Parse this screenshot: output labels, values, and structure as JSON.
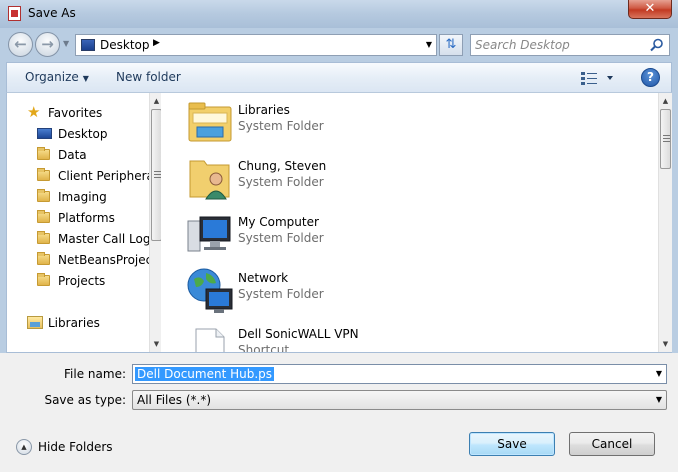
{
  "window": {
    "title": "Save As"
  },
  "address": {
    "location": "Desktop"
  },
  "search": {
    "placeholder": "Search Desktop"
  },
  "toolbar": {
    "organize_label": "Organize",
    "new_folder_label": "New folder"
  },
  "sidebar": {
    "favorites_label": "Favorites",
    "items": [
      {
        "label": "Desktop",
        "icon": "desktop-icon"
      },
      {
        "label": "Data",
        "icon": "folder-icon"
      },
      {
        "label": "Client Peripherals",
        "icon": "folder-icon"
      },
      {
        "label": "Imaging",
        "icon": "folder-icon"
      },
      {
        "label": "Platforms",
        "icon": "folder-icon"
      },
      {
        "label": "Master Call Logs",
        "icon": "folder-icon"
      },
      {
        "label": "NetBeansProjects",
        "icon": "folder-icon"
      },
      {
        "label": "Projects",
        "icon": "folder-icon"
      }
    ],
    "libraries_label": "Libraries"
  },
  "files": [
    {
      "name": "Libraries",
      "type": "System Folder",
      "icon": "libraries-icon"
    },
    {
      "name": "Chung, Steven",
      "type": "System Folder",
      "icon": "user-folder-icon"
    },
    {
      "name": "My Computer",
      "type": "System Folder",
      "icon": "computer-icon"
    },
    {
      "name": "Network",
      "type": "System Folder",
      "icon": "network-icon"
    },
    {
      "name": "Dell SonicWALL VPN",
      "type": "Shortcut",
      "icon": "shortcut-file-icon"
    }
  ],
  "form": {
    "filename_label": "File name:",
    "filename_value": "Dell Document Hub.ps",
    "savetype_label": "Save as type:",
    "savetype_value": "All Files (*.*)"
  },
  "footer": {
    "hide_folders_label": "Hide Folders",
    "save_label": "Save",
    "cancel_label": "Cancel"
  },
  "colors": {
    "accent": "#3399ff",
    "titlebar": "#b9cde2",
    "close": "#c23a22"
  }
}
